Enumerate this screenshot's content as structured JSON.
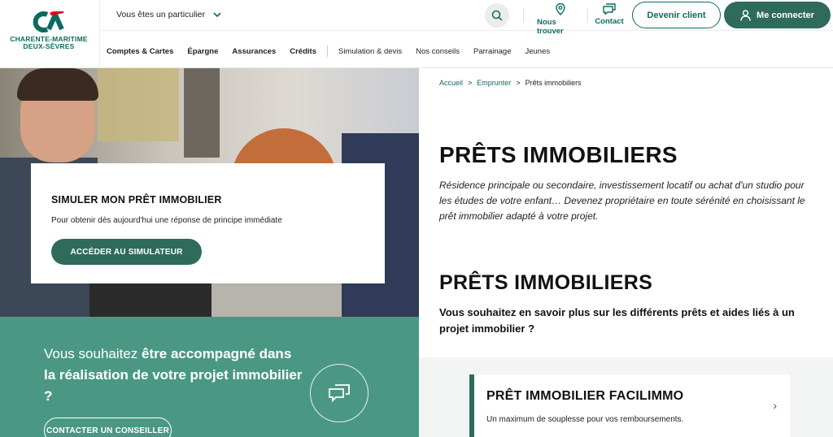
{
  "header": {
    "logo_text_line1": "CHARENTE-MARITIME",
    "logo_text_line2": "DEUX-SÈVRES",
    "profile_selector": "Vous êtes un particulier",
    "nous_trouver": "Nous trouver",
    "contact": "Contact",
    "devenir_client": "Devenir client",
    "me_connecter": "Me connecter",
    "nav": [
      {
        "label": "Comptes & Cartes"
      },
      {
        "label": "Épargne"
      },
      {
        "label": "Assurances"
      },
      {
        "label": "Crédits"
      },
      {
        "label": "Simulation & devis"
      },
      {
        "label": "Nos conseils"
      },
      {
        "label": "Parrainage"
      },
      {
        "label": "Jeunes"
      }
    ]
  },
  "simulator": {
    "title": "SIMULER MON PRÊT IMMOBILIER",
    "description": "Pour obtenir dès aujourd'hui une réponse de principe immédiate",
    "button": "ACCÉDER AU SIMULATEUR"
  },
  "advisor": {
    "text_start": "Vous souhaitez ",
    "text_bold": "être accompagné dans la réalisation de votre projet immobilier ?",
    "button": "CONTACTER UN CONSEILLER"
  },
  "breadcrumb": {
    "home": "Accueil",
    "section": "Emprunter",
    "current": "Prêts immobiliers",
    "separator": ">"
  },
  "main": {
    "title": "PRÊTS IMMOBILIERS",
    "intro": "Résidence principale ou secondaire, investissement locatif ou achat d'un studio pour les études de votre enfant… Devenez propriétaire en toute sérénité en choisissant le prêt immobilier adapté à votre projet.",
    "title2": "PRÊTS IMMOBILIERS",
    "subtitle": "Vous souhaitez en savoir plus sur les différents prêts et aides liés à un projet immobilier ?"
  },
  "loan_card": {
    "title": "PRÊT IMMOBILIER FACILIMMO",
    "description": "Un maximum de souplesse pour vos remboursements."
  },
  "colors": {
    "brand_green": "#0d6b5e",
    "button_green": "#2e6b5b",
    "band_green": "#4a9884"
  }
}
